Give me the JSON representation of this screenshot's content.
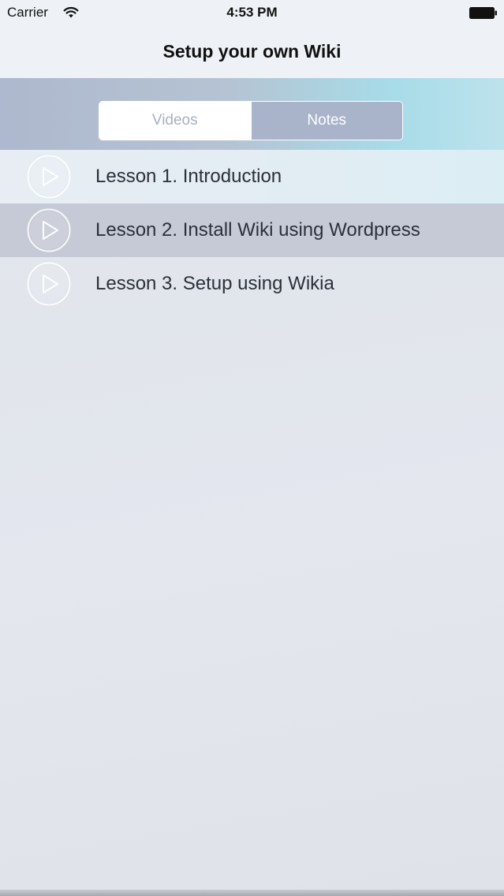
{
  "status_bar": {
    "carrier": "Carrier",
    "time": "4:53 PM",
    "wifi_icon": "wifi-icon",
    "battery_icon": "battery-icon"
  },
  "nav": {
    "title": "Setup your own Wiki"
  },
  "segmented_control": {
    "options": [
      "Videos",
      "Notes"
    ],
    "selected": "Notes"
  },
  "lessons": [
    {
      "label": "Lesson 1. Introduction",
      "icon": "play-icon"
    },
    {
      "label": "Lesson 2. Install Wiki using Wordpress",
      "icon": "play-icon",
      "selected": true
    },
    {
      "label": "Lesson 3. Setup using Wikia",
      "icon": "play-icon"
    }
  ],
  "colors": {
    "segment_selected": "#a9b4ca",
    "row_selected": "#c6cad6",
    "band_accent": "#a7dce8"
  }
}
